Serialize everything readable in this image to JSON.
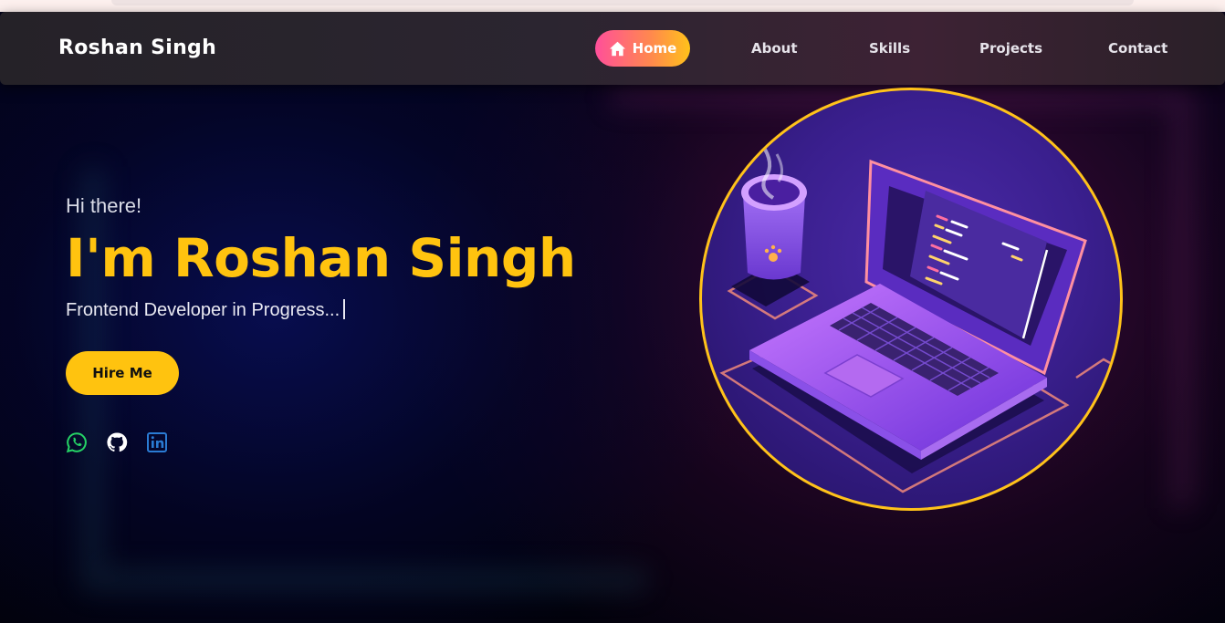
{
  "nav": {
    "brand": "Roshan Singh",
    "items": [
      {
        "label": "Home",
        "icon": "home-icon",
        "active": true
      },
      {
        "label": "About"
      },
      {
        "label": "Skills"
      },
      {
        "label": "Projects"
      },
      {
        "label": "Contact"
      }
    ]
  },
  "hero": {
    "greeting": "Hi there!",
    "headline": "I'm Roshan Singh",
    "role": "Frontend Developer in Progress...",
    "cta": "Hire Me",
    "social": [
      {
        "icon": "whatsapp-icon",
        "color": "#25d366"
      },
      {
        "icon": "github-icon",
        "color": "#ffffff"
      },
      {
        "icon": "linkedin-icon",
        "color": "#2a7bd4"
      }
    ]
  },
  "colors": {
    "accent": "#ffc30f",
    "home_gradient": [
      "#ff4f9a",
      "#ffc21a"
    ]
  }
}
